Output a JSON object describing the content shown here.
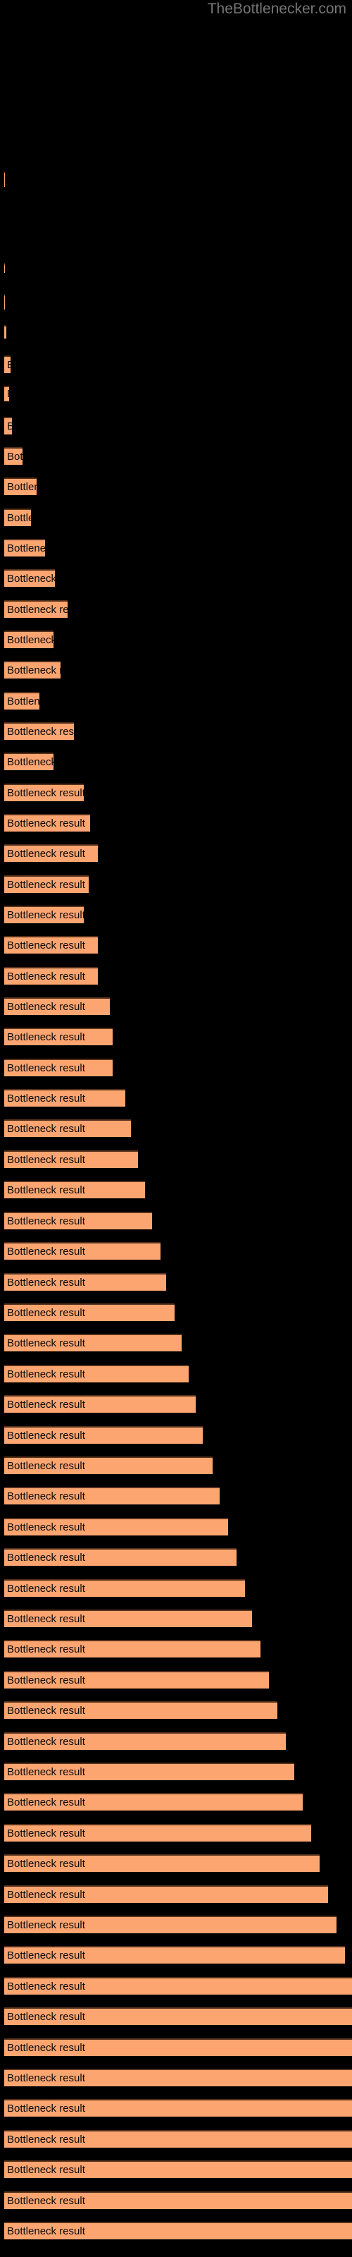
{
  "watermark": "TheBottlenecker.com",
  "colors": {
    "background": "#000000",
    "bar_fill": "#fca570",
    "bar_border_top": "#55301a",
    "bar_label_text": "#0a0a0a",
    "watermark_text": "#757575"
  },
  "chart_data": {
    "type": "bar",
    "orientation": "horizontal",
    "title": "",
    "subtitle": "",
    "xlabel": "",
    "ylabel": "",
    "grid": false,
    "legend": null,
    "axis_visible": false,
    "bar_label_text": "Bottleneck result",
    "xlim": [
      0,
      500
    ],
    "categories": [
      "Bottleneck result",
      "Bottleneck result",
      "Bottleneck result",
      "Bottleneck result",
      "Bottleneck result",
      "Bottleneck result",
      "Bottleneck result",
      "Bottleneck result",
      "Bottleneck result",
      "Bottleneck result",
      "Bottleneck result",
      "Bottleneck result",
      "Bottleneck result",
      "Bottleneck result",
      "Bottleneck result",
      "Bottleneck result",
      "Bottleneck result",
      "Bottleneck result",
      "Bottleneck result",
      "Bottleneck result",
      "Bottleneck result",
      "Bottleneck result",
      "Bottleneck result",
      "Bottleneck result",
      "Bottleneck result",
      "Bottleneck result",
      "Bottleneck result",
      "Bottleneck result",
      "Bottleneck result",
      "Bottleneck result",
      "Bottleneck result"
    ],
    "values": [
      1,
      1,
      1,
      3,
      9,
      7,
      11,
      26,
      46,
      38,
      58,
      72,
      90,
      70,
      80,
      50,
      99,
      70,
      113,
      122,
      133,
      120,
      113,
      133,
      133,
      150,
      154,
      154,
      172,
      180,
      190
    ],
    "bars": [
      {
        "y": 243,
        "height": 22,
        "width": 1,
        "label": "Bottleneck result"
      },
      {
        "y": 373,
        "height": 14,
        "width": 1,
        "label": "Bottleneck result"
      },
      {
        "y": 417,
        "height": 22,
        "width": 1,
        "label": "Bottleneck result"
      },
      {
        "y": 461,
        "height": 19,
        "width": 3,
        "label": "Bottleneck result"
      },
      {
        "y": 504,
        "height": 25,
        "width": 9,
        "label": "Bottleneck result"
      },
      {
        "y": 547,
        "height": 22,
        "width": 7,
        "label": "Bottleneck result"
      },
      {
        "y": 591,
        "height": 25,
        "width": 11,
        "label": "Bottleneck result"
      },
      {
        "y": 634,
        "height": 25,
        "width": 26,
        "label": "Bottleneck result"
      },
      {
        "y": 677,
        "height": 25,
        "width": 46,
        "label": "Bottleneck result"
      },
      {
        "y": 721,
        "height": 25,
        "width": 38,
        "label": "Bottleneck result"
      },
      {
        "y": 764,
        "height": 25,
        "width": 58,
        "label": "Bottleneck result"
      },
      {
        "y": 807,
        "height": 25,
        "width": 72,
        "label": "Bottleneck result"
      },
      {
        "y": 851,
        "height": 25,
        "width": 90,
        "label": "Bottleneck result"
      },
      {
        "y": 894,
        "height": 25,
        "width": 70,
        "label": "Bottleneck result"
      },
      {
        "y": 937,
        "height": 25,
        "width": 80,
        "label": "Bottleneck result"
      },
      {
        "y": 981,
        "height": 25,
        "width": 50,
        "label": "Bottleneck result"
      },
      {
        "y": 1024,
        "height": 25,
        "width": 99,
        "label": "Bottleneck result"
      },
      {
        "y": 1067,
        "height": 25,
        "width": 70,
        "label": "Bottleneck result"
      },
      {
        "y": 1111,
        "height": 25,
        "width": 113,
        "label": "Bottleneck result"
      },
      {
        "y": 1154,
        "height": 25,
        "width": 122,
        "label": "Bottleneck result"
      },
      {
        "y": 1197,
        "height": 25,
        "width": 133,
        "label": "Bottleneck result"
      },
      {
        "y": 1241,
        "height": 25,
        "width": 120,
        "label": "Bottleneck result"
      },
      {
        "y": 1284,
        "height": 25,
        "width": 113,
        "label": "Bottleneck result"
      },
      {
        "y": 1327,
        "height": 25,
        "width": 133,
        "label": "Bottleneck result"
      },
      {
        "y": 1371,
        "height": 25,
        "width": 133,
        "label": "Bottleneck result"
      },
      {
        "y": 1414,
        "height": 25,
        "width": 150,
        "label": "Bottleneck result"
      },
      {
        "y": 1457,
        "height": 25,
        "width": 154,
        "label": "Bottleneck result"
      },
      {
        "y": 1501,
        "height": 25,
        "width": 154,
        "label": "Bottleneck result"
      },
      {
        "y": 1544,
        "height": 25,
        "width": 172,
        "label": "Bottleneck result"
      },
      {
        "y": 1587,
        "height": 25,
        "width": 180,
        "label": "Bottleneck result"
      },
      {
        "y": 1631,
        "height": 25,
        "width": 190,
        "label": "Bottleneck result"
      }
    ]
  }
}
